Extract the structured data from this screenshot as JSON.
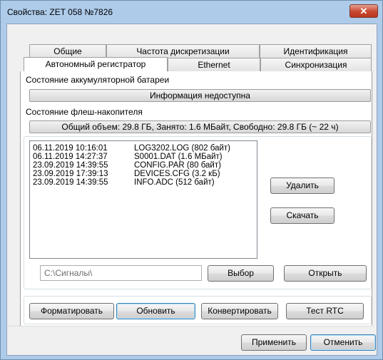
{
  "window": {
    "title": "Свойства: ZET 058 №7826",
    "close_glyph": "✕"
  },
  "tabs_row1": [
    {
      "label": "Общие"
    },
    {
      "label": "Частота дискретизации"
    },
    {
      "label": "Идентификация"
    }
  ],
  "tabs_row2": [
    {
      "label": "Автономный регистратор",
      "active": true
    },
    {
      "label": "Ethernet"
    },
    {
      "label": "Синхронизация"
    }
  ],
  "battery": {
    "label": "Состояние аккумуляторной батареи",
    "status": "Информация недоступна"
  },
  "flash": {
    "label": "Состояние флеш-накопителя",
    "status": "Общий объем: 29.8 ГБ, Занято: 1.6 МБайт, Свободно: 29.8 ГБ (~ 22 ч)"
  },
  "files": [
    {
      "date": "06.11.2019 10:16:01",
      "name": "LOG3202.LOG (802 байт)"
    },
    {
      "date": "06.11.2019 14:27:37",
      "name": "S0001.DAT (1.6 МБайт)"
    },
    {
      "date": "23.09.2019 14:39:55",
      "name": "CONFIG.PAR (80 байт)"
    },
    {
      "date": "23.09.2019 17:39:13",
      "name": "DEVICES.CFG (3.2 кБ)"
    },
    {
      "date": "23.09.2019 14:39:55",
      "name": "INFO.ADC (512 байт)"
    }
  ],
  "buttons": {
    "delete": "Удалить",
    "download": "Скачать",
    "choose": "Выбор",
    "open": "Открыть",
    "format": "Форматировать",
    "refresh": "Обновить",
    "convert": "Конвертировать",
    "rtc": "Тест RTC",
    "apply": "Применить",
    "cancel": "Отменить"
  },
  "path_field": {
    "value": "C:\\Сигналы\\"
  }
}
